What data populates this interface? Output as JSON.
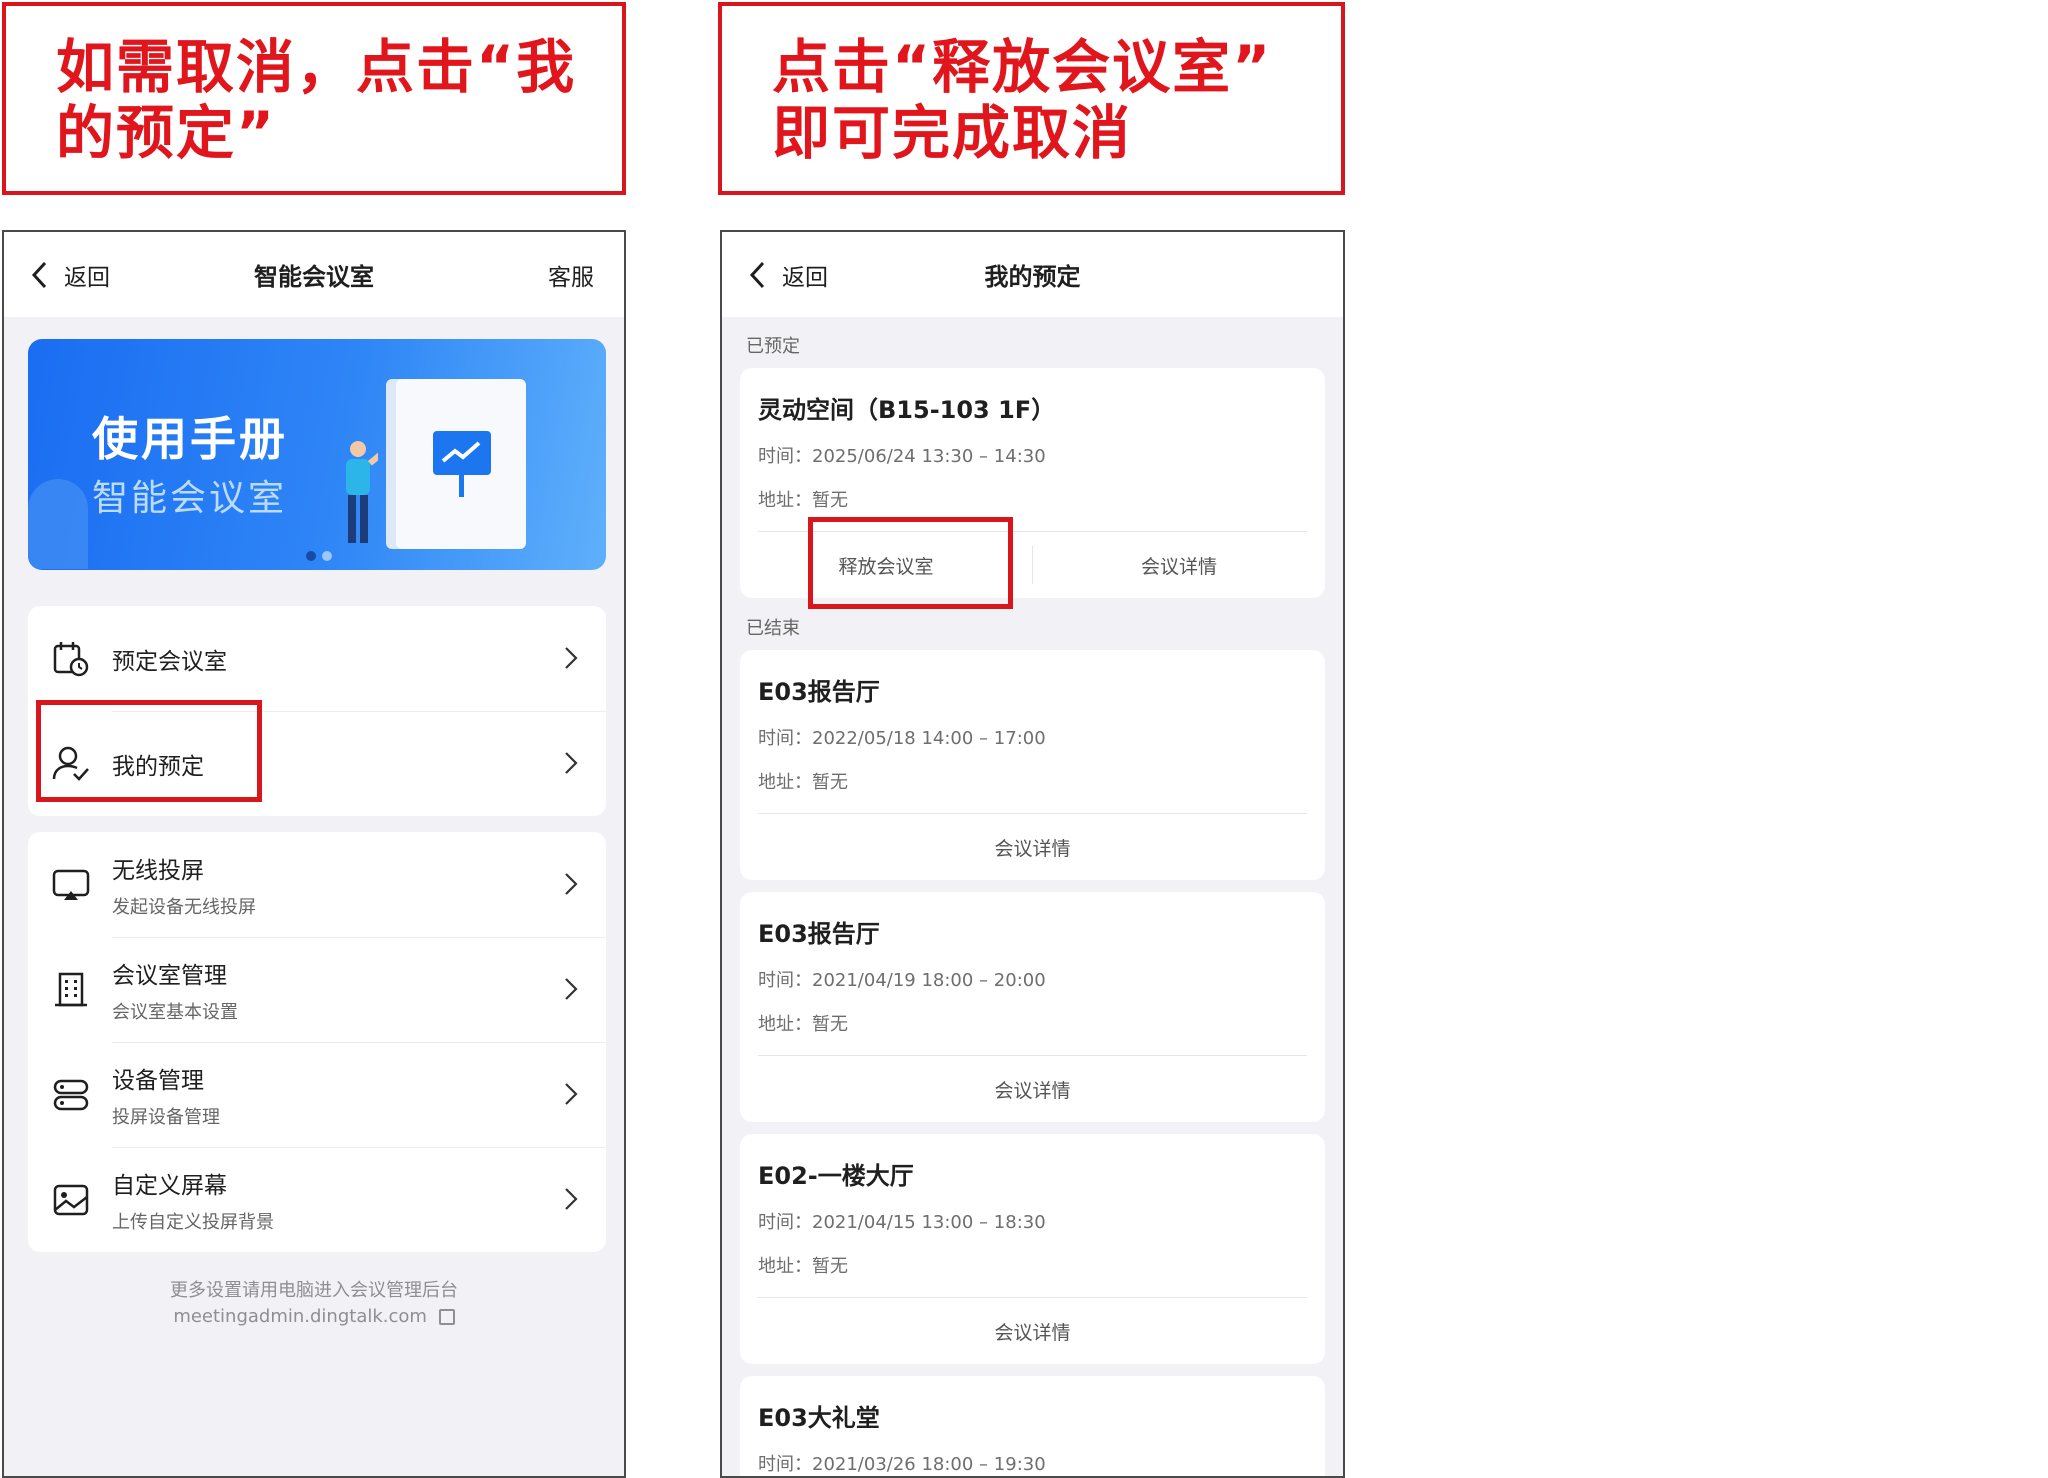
{
  "callouts": [
    {
      "text": "如需取消，点击“我\n的预定”"
    },
    {
      "text": "点击“释放会议室”\n即可完成取消"
    }
  ],
  "left_screen": {
    "nav": {
      "back": "返回",
      "title": "智能会议室",
      "right": "客服"
    },
    "banner": {
      "title": "使用手册",
      "subtitle": "智能会议室"
    },
    "menu_group_1": [
      {
        "label": "预定会议室",
        "icon": "calendar-clock-icon"
      },
      {
        "label": "我的预定",
        "icon": "user-check-icon"
      }
    ],
    "menu_group_2": [
      {
        "label": "无线投屏",
        "sub": "发起设备无线投屏",
        "icon": "screen-cast-icon"
      },
      {
        "label": "会议室管理",
        "sub": "会议室基本设置",
        "icon": "building-icon"
      },
      {
        "label": "设备管理",
        "sub": "投屏设备管理",
        "icon": "device-icon"
      },
      {
        "label": "自定义屏幕",
        "sub": "上传自定义投屏背景",
        "icon": "image-icon"
      }
    ],
    "footer": {
      "line1": "更多设置请用电脑进入会议管理后台",
      "line2": "meetingadmin.dingtalk.com"
    }
  },
  "right_screen": {
    "nav": {
      "back": "返回",
      "title": "我的预定"
    },
    "section_booked": "已预定",
    "section_ended": "已结束",
    "booked": [
      {
        "title": "灵动空间（B15-103 1F）",
        "time": "时间：2025/06/24 13:30 – 14:30",
        "addr": "地址：暂无",
        "release": "释放会议室",
        "detail": "会议详情"
      }
    ],
    "ended": [
      {
        "title": "E03报告厅",
        "time": "时间：2022/05/18 14:00 – 17:00",
        "addr": "地址：暂无",
        "detail": "会议详情"
      },
      {
        "title": "E03报告厅",
        "time": "时间：2021/04/19 18:00 – 20:00",
        "addr": "地址：暂无",
        "detail": "会议详情"
      },
      {
        "title": "E02-一楼大厅",
        "time": "时间：2021/04/15 13:00 – 18:30",
        "addr": "地址：暂无",
        "detail": "会议详情"
      },
      {
        "title": "E03大礼堂",
        "time": "时间：2021/03/26 18:00 – 19:30"
      }
    ]
  },
  "colors": {
    "highlight_red": "#d9161c",
    "banner_blue": "#1a6df2"
  }
}
